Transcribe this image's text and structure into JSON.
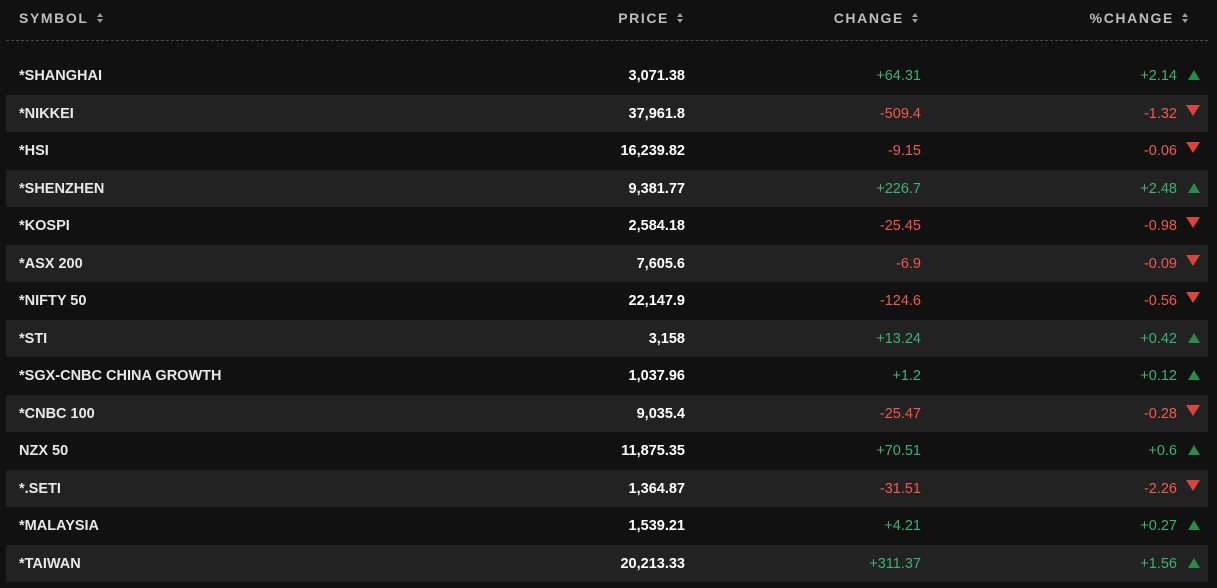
{
  "header": {
    "symbol": "SYMBOL",
    "price": "PRICE",
    "change": "CHANGE",
    "pct_change": "%CHANGE"
  },
  "colors": {
    "positive": "#3cb371",
    "negative": "#f15a4a",
    "background": "#111111",
    "row_alt": "#222222"
  },
  "rows": [
    {
      "symbol": "*SHANGHAI",
      "price": "3,071.38",
      "change": "+64.31",
      "pct": "+2.14",
      "dir": "up"
    },
    {
      "symbol": "*NIKKEI",
      "price": "37,961.8",
      "change": "-509.4",
      "pct": "-1.32",
      "dir": "down"
    },
    {
      "symbol": "*HSI",
      "price": "16,239.82",
      "change": "-9.15",
      "pct": "-0.06",
      "dir": "down"
    },
    {
      "symbol": "*SHENZHEN",
      "price": "9,381.77",
      "change": "+226.7",
      "pct": "+2.48",
      "dir": "up"
    },
    {
      "symbol": "*KOSPI",
      "price": "2,584.18",
      "change": "-25.45",
      "pct": "-0.98",
      "dir": "down"
    },
    {
      "symbol": "*ASX 200",
      "price": "7,605.6",
      "change": "-6.9",
      "pct": "-0.09",
      "dir": "down"
    },
    {
      "symbol": "*NIFTY 50",
      "price": "22,147.9",
      "change": "-124.6",
      "pct": "-0.56",
      "dir": "down"
    },
    {
      "symbol": "*STI",
      "price": "3,158",
      "change": "+13.24",
      "pct": "+0.42",
      "dir": "up"
    },
    {
      "symbol": "*SGX-CNBC CHINA GROWTH",
      "price": "1,037.96",
      "change": "+1.2",
      "pct": "+0.12",
      "dir": "up"
    },
    {
      "symbol": "*CNBC 100",
      "price": "9,035.4",
      "change": "-25.47",
      "pct": "-0.28",
      "dir": "down"
    },
    {
      "symbol": "NZX 50",
      "price": "11,875.35",
      "change": "+70.51",
      "pct": "+0.6",
      "dir": "up"
    },
    {
      "symbol": "*.SETI",
      "price": "1,364.87",
      "change": "-31.51",
      "pct": "-2.26",
      "dir": "down"
    },
    {
      "symbol": "*MALAYSIA",
      "price": "1,539.21",
      "change": "+4.21",
      "pct": "+0.27",
      "dir": "up"
    },
    {
      "symbol": "*TAIWAN",
      "price": "20,213.33",
      "change": "+311.37",
      "pct": "+1.56",
      "dir": "up"
    }
  ]
}
